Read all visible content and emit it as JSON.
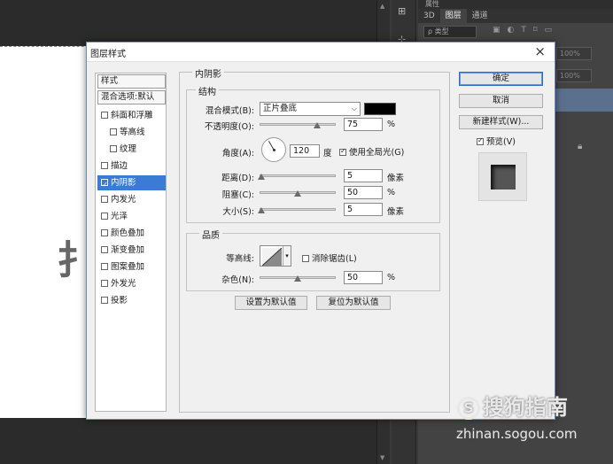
{
  "dialog": {
    "title": "图层样式",
    "close": "×"
  },
  "style_list": {
    "header": "样式",
    "blend_options": "混合选项:默认",
    "items": [
      {
        "label": "斜面和浮雕",
        "checked": false,
        "sub": false,
        "selected": false
      },
      {
        "label": "等高线",
        "checked": false,
        "sub": true,
        "selected": false
      },
      {
        "label": "纹理",
        "checked": false,
        "sub": true,
        "selected": false
      },
      {
        "label": "描边",
        "checked": false,
        "sub": false,
        "selected": false
      },
      {
        "label": "内阴影",
        "checked": true,
        "sub": false,
        "selected": true
      },
      {
        "label": "内发光",
        "checked": false,
        "sub": false,
        "selected": false
      },
      {
        "label": "光泽",
        "checked": false,
        "sub": false,
        "selected": false
      },
      {
        "label": "颜色叠加",
        "checked": false,
        "sub": false,
        "selected": false
      },
      {
        "label": "渐变叠加",
        "checked": false,
        "sub": false,
        "selected": false
      },
      {
        "label": "图案叠加",
        "checked": false,
        "sub": false,
        "selected": false
      },
      {
        "label": "外发光",
        "checked": false,
        "sub": false,
        "selected": false
      },
      {
        "label": "投影",
        "checked": false,
        "sub": false,
        "selected": false
      }
    ]
  },
  "panel": {
    "title": "内阴影",
    "structure": {
      "legend": "结构",
      "blend_mode_label": "混合模式(B):",
      "blend_mode_value": "正片叠底",
      "shadow_color": "#000000",
      "opacity_label": "不透明度(O):",
      "opacity_value": "75",
      "opacity_unit": "%",
      "opacity_fraction": 0.75,
      "angle_label": "角度(A):",
      "angle_value": "120",
      "angle_unit": "度",
      "global_light_label": "使用全局光(G)",
      "global_light_checked": true,
      "distance_label": "距离(D):",
      "distance_value": "5",
      "distance_unit": "像素",
      "distance_fraction": 0.02,
      "choke_label": "阻塞(C):",
      "choke_value": "50",
      "choke_unit": "%",
      "choke_fraction": 0.5,
      "size_label": "大小(S):",
      "size_value": "5",
      "size_unit": "像素",
      "size_fraction": 0.02
    },
    "quality": {
      "legend": "品质",
      "contour_label": "等高线:",
      "antialias_label": "消除锯齿(L)",
      "antialias_checked": false,
      "noise_label": "杂色(N):",
      "noise_value": "50",
      "noise_unit": "%",
      "noise_fraction": 0.5
    },
    "make_default": "设置为默认值",
    "reset_default": "复位为默认值"
  },
  "buttons": {
    "ok": "确定",
    "cancel": "取消",
    "new_style": "新建样式(W)...",
    "preview_label": "预览(V)",
    "preview_checked": true
  },
  "ps": {
    "panel_top": "属性",
    "tabs": [
      "3D",
      "图层",
      "通道"
    ],
    "filter_label": "ρ 类型",
    "field_1": "100%",
    "field_2": "100%"
  },
  "watermark": {
    "logo": "S",
    "text": "搜狗指南",
    "url": "zhinan.sogou.com"
  }
}
